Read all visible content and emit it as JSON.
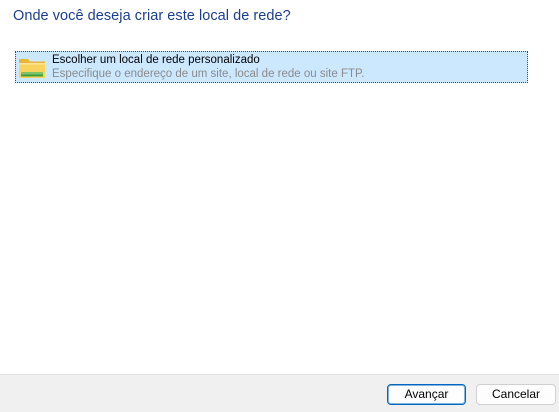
{
  "header": {
    "title": "Onde você deseja criar este local de rede?"
  },
  "options": [
    {
      "icon": "folder-icon",
      "title": "Escolher um local de rede personalizado",
      "description": "Especifique o endereço de um site, local de rede ou site FTP.",
      "selected": true
    }
  ],
  "footer": {
    "next_label": "Avançar",
    "cancel_label": "Cancelar"
  },
  "colors": {
    "heading": "#1a3e8f",
    "selection_bg": "#cce8ff",
    "footer_bg": "#f0f0f0",
    "primary_button_border": "#0067c0"
  }
}
